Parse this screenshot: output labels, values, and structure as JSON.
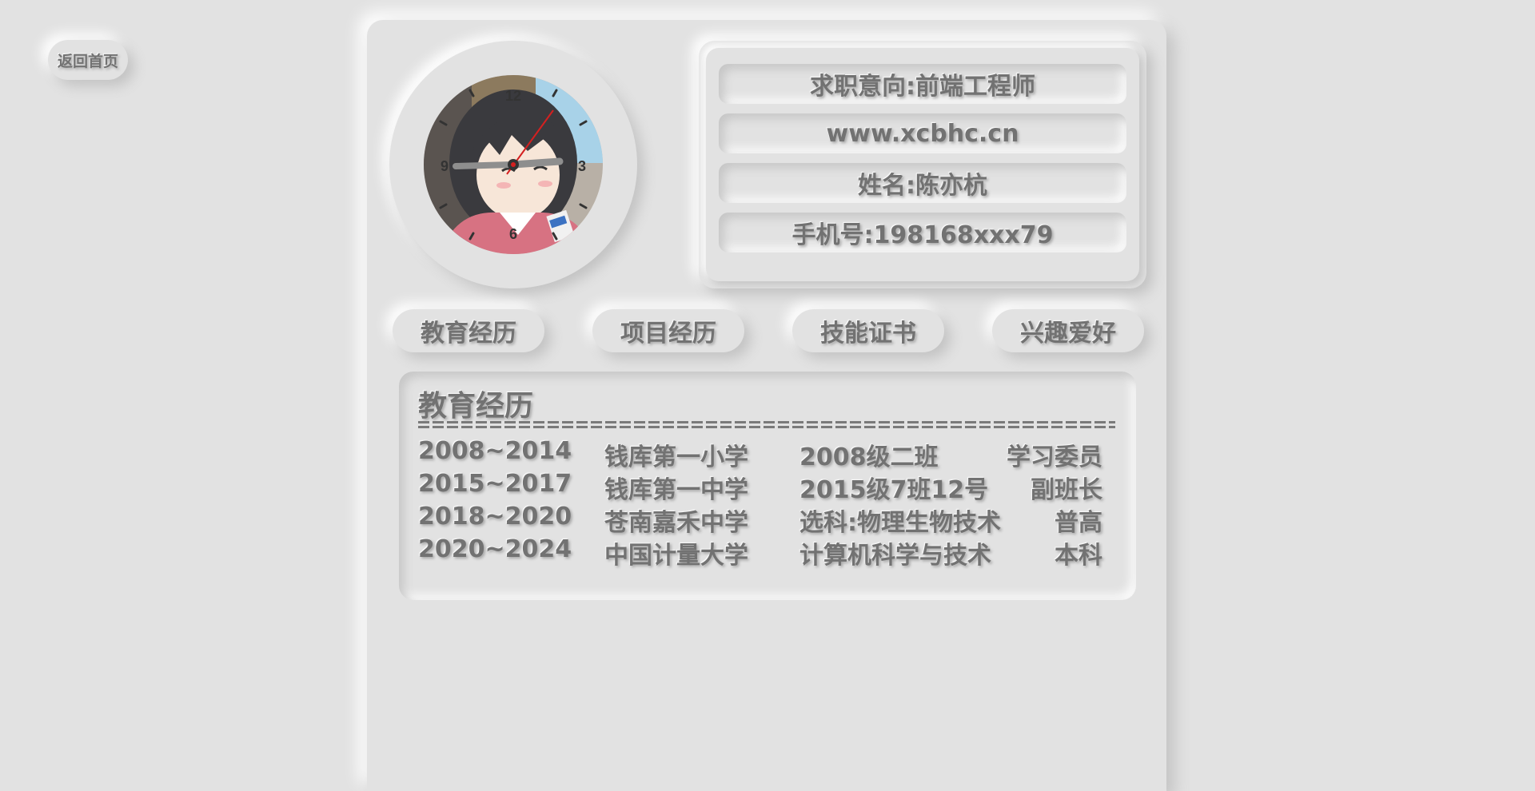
{
  "back_button": {
    "label": "返回首页"
  },
  "clock": {
    "numerals": [
      "12",
      "3",
      "6",
      "9"
    ]
  },
  "info": [
    "求职意向:前端工程师",
    "www.xcbhc.cn",
    "姓名:陈亦杭",
    "手机号:198168xxx79"
  ],
  "tabs": [
    "教育经历",
    "项目经历",
    "技能证书",
    "兴趣爱好"
  ],
  "section": {
    "title": "教育经历",
    "rows": [
      [
        "2008~2014",
        "钱库第一小学",
        "2008级二班",
        "学习委员"
      ],
      [
        "2015~2017",
        "钱库第一中学",
        "2015级7班12号",
        "副班长"
      ],
      [
        "2018~2020",
        "苍南嘉禾中学",
        "选科:物理生物技术",
        "普高"
      ],
      [
        "2020~2024",
        "中国计量大学",
        "计算机科学与技术",
        "本科"
      ]
    ]
  }
}
